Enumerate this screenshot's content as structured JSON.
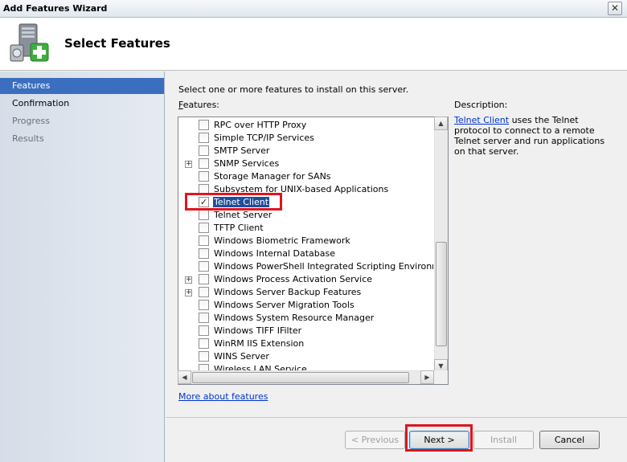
{
  "window": {
    "title": "Add Features Wizard",
    "close_glyph": "✕"
  },
  "header": {
    "title": "Select Features",
    "icon": "server-add-icon"
  },
  "sidebar": {
    "steps": [
      {
        "label": "Features",
        "state": "active"
      },
      {
        "label": "Confirmation",
        "state": "enabled"
      },
      {
        "label": "Progress",
        "state": "disabled"
      },
      {
        "label": "Results",
        "state": "disabled"
      }
    ]
  },
  "main": {
    "instruction": "Select one or more features to install on this server.",
    "features_label_accel": "F",
    "features_label_rest": "eatures:",
    "features": [
      {
        "label": "RPC over HTTP Proxy",
        "checked": false,
        "expandable": false
      },
      {
        "label": "Simple TCP/IP Services",
        "checked": false,
        "expandable": false
      },
      {
        "label": "SMTP Server",
        "checked": false,
        "expandable": false
      },
      {
        "label": "SNMP Services",
        "checked": false,
        "expandable": true
      },
      {
        "label": "Storage Manager for SANs",
        "checked": false,
        "expandable": false
      },
      {
        "label": "Subsystem for UNIX-based Applications",
        "checked": false,
        "expandable": false
      },
      {
        "label": "Telnet Client",
        "checked": true,
        "expandable": false,
        "selected": true
      },
      {
        "label": "Telnet Server",
        "checked": false,
        "expandable": false
      },
      {
        "label": "TFTP Client",
        "checked": false,
        "expandable": false
      },
      {
        "label": "Windows Biometric Framework",
        "checked": false,
        "expandable": false
      },
      {
        "label": "Windows Internal Database",
        "checked": false,
        "expandable": false
      },
      {
        "label": "Windows PowerShell Integrated Scripting Environment (IS",
        "checked": false,
        "expandable": false
      },
      {
        "label": "Windows Process Activation Service",
        "checked": false,
        "expandable": true
      },
      {
        "label": "Windows Server Backup Features",
        "checked": false,
        "expandable": true
      },
      {
        "label": "Windows Server Migration Tools",
        "checked": false,
        "expandable": false
      },
      {
        "label": "Windows System Resource Manager",
        "checked": false,
        "expandable": false
      },
      {
        "label": "Windows TIFF IFilter",
        "checked": false,
        "expandable": false
      },
      {
        "label": "WinRM IIS Extension",
        "checked": false,
        "expandable": false
      },
      {
        "label": "WINS Server",
        "checked": false,
        "expandable": false
      },
      {
        "label": "Wireless LAN Service",
        "checked": false,
        "expandable": false
      }
    ],
    "description_label": "Description:",
    "description_link": "Telnet Client",
    "description_text": " uses the Telnet protocol to connect to a remote Telnet server and run applications on that server.",
    "more_link": "More about features",
    "scroll_glyphs": {
      "up": "▲",
      "down": "▼",
      "left": "◀",
      "right": "▶"
    },
    "check_glyph": "✓",
    "expand_glyph": "+"
  },
  "footer": {
    "previous": "< Previous",
    "next": "Next >",
    "install": "Install",
    "cancel": "Cancel"
  },
  "colors": {
    "highlight_box": "#e0141e",
    "sidebar_active": "#3c6ebf",
    "selected_item": "#1f4e9c",
    "link": "#0033cc"
  }
}
